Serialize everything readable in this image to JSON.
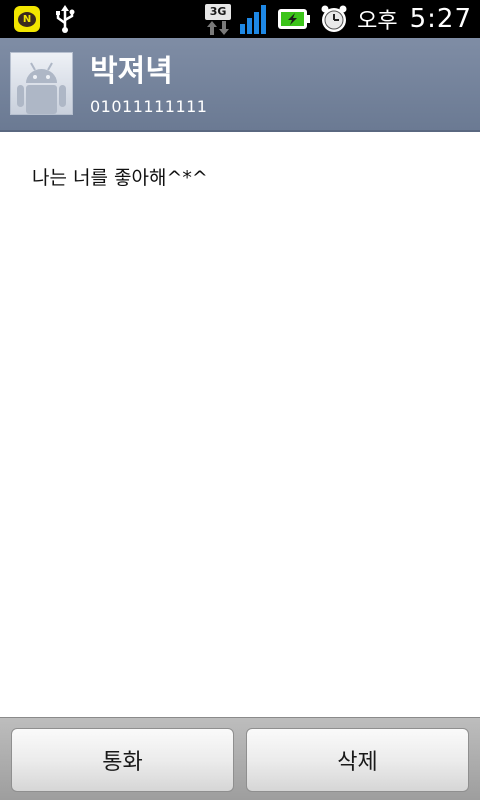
{
  "status_bar": {
    "notification_icons": [
      "kakao-talk-icon",
      "usb-icon"
    ],
    "network_label": "3G",
    "signal_icon": "signal-bars-icon",
    "battery_icon": "battery-charging-icon",
    "alarm_icon": "alarm-clock-icon",
    "ampm": "오후",
    "time": "5:27",
    "kakao_letter": "N"
  },
  "contact": {
    "avatar_icon": "android-avatar-icon",
    "name": "박져녁",
    "number": "01011111111"
  },
  "message": {
    "text": "나는 너를 좋아해^*^"
  },
  "actions": {
    "call_label": "통화",
    "delete_label": "삭제"
  },
  "colors": {
    "header_bg": "#7482 9b",
    "status_bg": "#000000",
    "battery_green": "#3cc41a",
    "signal_blue": "#1e88e5"
  }
}
